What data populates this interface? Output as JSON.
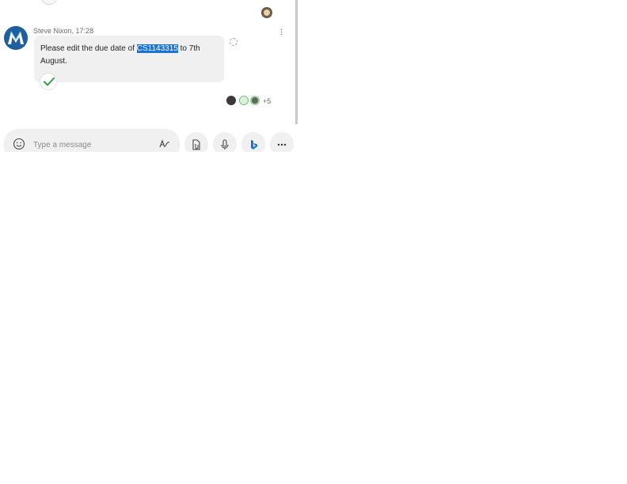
{
  "message": {
    "sender": "Steve Nixon",
    "time": "17:28",
    "text_before": "Please edit the due date of ",
    "text_highlight": "CS1143315",
    "text_after": " to 7th August."
  },
  "read_receipts": {
    "extra_count": "+5"
  },
  "composer": {
    "placeholder": "Type a message"
  },
  "colors": {
    "selection": "#1a73d9",
    "bubble": "#f0f0f0",
    "check": "#2ea043"
  }
}
